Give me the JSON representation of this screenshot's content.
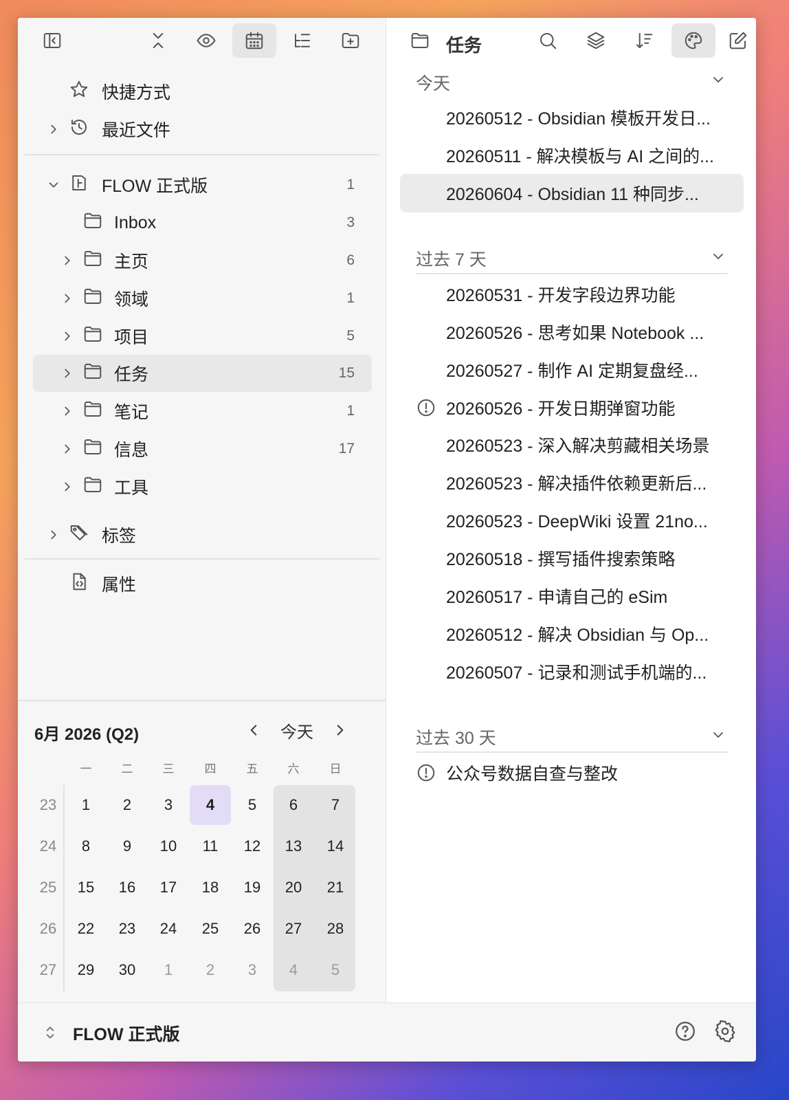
{
  "left": {
    "shortcuts_label": "快捷方式",
    "recent_label": "最近文件",
    "vault": {
      "name": "FLOW 正式版",
      "count": "1"
    },
    "folders": [
      {
        "name": "Inbox",
        "count": "3"
      },
      {
        "name": "主页",
        "count": "6"
      },
      {
        "name": "领域",
        "count": "1"
      },
      {
        "name": "项目",
        "count": "5"
      },
      {
        "name": "任务",
        "count": "15"
      },
      {
        "name": "笔记",
        "count": "1"
      },
      {
        "name": "信息",
        "count": "17"
      },
      {
        "name": "工具",
        "count": ""
      }
    ],
    "tags_label": "标签",
    "properties_label": "属性"
  },
  "calendar": {
    "title": "6月 2026 (Q2)",
    "today_label": "今天",
    "weekdays": [
      "一",
      "二",
      "三",
      "四",
      "五",
      "六",
      "日"
    ],
    "weeks": [
      {
        "num": "23",
        "days": [
          "1",
          "2",
          "3",
          "4",
          "5",
          "6",
          "7"
        ]
      },
      {
        "num": "24",
        "days": [
          "8",
          "9",
          "10",
          "11",
          "12",
          "13",
          "14"
        ]
      },
      {
        "num": "25",
        "days": [
          "15",
          "16",
          "17",
          "18",
          "19",
          "20",
          "21"
        ]
      },
      {
        "num": "26",
        "days": [
          "22",
          "23",
          "24",
          "25",
          "26",
          "27",
          "28"
        ]
      },
      {
        "num": "27",
        "days": [
          "29",
          "30",
          "1",
          "2",
          "3",
          "4",
          "5"
        ]
      }
    ],
    "today_day": "4",
    "accent_color": "#e2dcf7"
  },
  "right": {
    "title": "任务",
    "sections": [
      {
        "label": "今天",
        "files": [
          "20260512 - Obsidian 模板开发日...",
          "20260511 - 解决模板与 AI 之间的...",
          "20260604 - Obsidian 11 种同步..."
        ]
      },
      {
        "label": "过去 7 天",
        "files": [
          "20260531 - 开发字段边界功能",
          "20260526 - 思考如果 Notebook ...",
          "20260527 - 制作 AI 定期复盘经...",
          "20260526 - 开发日期弹窗功能",
          "20260523 - 深入解决剪藏相关场景",
          "20260523 - 解决插件依赖更新后...",
          "20260523 - DeepWiki 设置 21no...",
          "20260518 - 撰写插件搜索策略",
          "20260517 - 申请自己的 eSim",
          "20260512 - 解决 Obsidian 与 Op...",
          "20260507 - 记录和测试手机端的..."
        ]
      },
      {
        "label": "过去 30 天",
        "files": [
          "公众号数据自查与整改"
        ]
      }
    ]
  },
  "bottom": {
    "vault_name": "FLOW 正式版"
  }
}
